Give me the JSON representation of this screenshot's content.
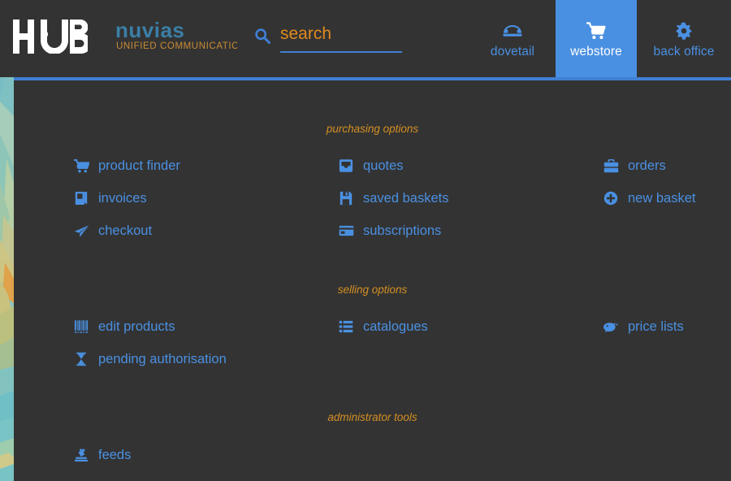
{
  "header": {
    "hub_logo_text": "HUB",
    "brand_name": "nuvias",
    "brand_tagline": "UNIFIED COMMUNICATIONS",
    "search": {
      "icon": "search-icon",
      "value": "",
      "placeholder": "search"
    },
    "nav": [
      {
        "id": "dovetail",
        "label": "dovetail",
        "icon": "phone-icon",
        "active": false
      },
      {
        "id": "webstore",
        "label": "webstore",
        "icon": "cart-icon",
        "active": true
      },
      {
        "id": "backoffice",
        "label": "back office",
        "icon": "gear-icon",
        "active": false
      }
    ]
  },
  "sections": [
    {
      "id": "purchasing-options",
      "heading": "purchasing options",
      "rows": [
        [
          {
            "label": "product finder",
            "icon": "shopping-cart-icon"
          },
          {
            "label": "quotes",
            "icon": "inbox-icon"
          },
          {
            "label": "orders",
            "icon": "briefcase-icon"
          }
        ],
        [
          {
            "label": "invoices",
            "icon": "book-icon"
          },
          {
            "label": "saved baskets",
            "icon": "floppy-disk-icon"
          },
          {
            "label": "new basket",
            "icon": "plus-circle-icon"
          }
        ],
        [
          {
            "label": "checkout",
            "icon": "paper-plane-icon"
          },
          {
            "label": "subscriptions",
            "icon": "credit-card-icon"
          },
          null
        ]
      ]
    },
    {
      "id": "selling-options",
      "heading": "selling options",
      "rows": [
        [
          {
            "label": "edit products",
            "icon": "barcode-icon"
          },
          {
            "label": "catalogues",
            "icon": "list-icon"
          },
          {
            "label": "price lists",
            "icon": "piggy-bank-icon"
          }
        ],
        [
          {
            "label": "pending authorisation",
            "icon": "hourglass-icon"
          },
          null,
          null
        ]
      ]
    },
    {
      "id": "administrator-tools",
      "heading": "administrator tools",
      "rows": [
        [
          {
            "label": "feeds",
            "icon": "feed-machine-icon"
          },
          null,
          null
        ]
      ]
    }
  ],
  "colors": {
    "background": "#333333",
    "accent_blue": "#4a90e2",
    "rule_blue": "#3f7fd4",
    "heading_orange": "#d48f22",
    "search_orange": "#e08a1e",
    "brand_blue": "#3b7fa6",
    "brand_tagline_orange": "#c98b35",
    "nav_active_bg": "#4a90e2"
  }
}
